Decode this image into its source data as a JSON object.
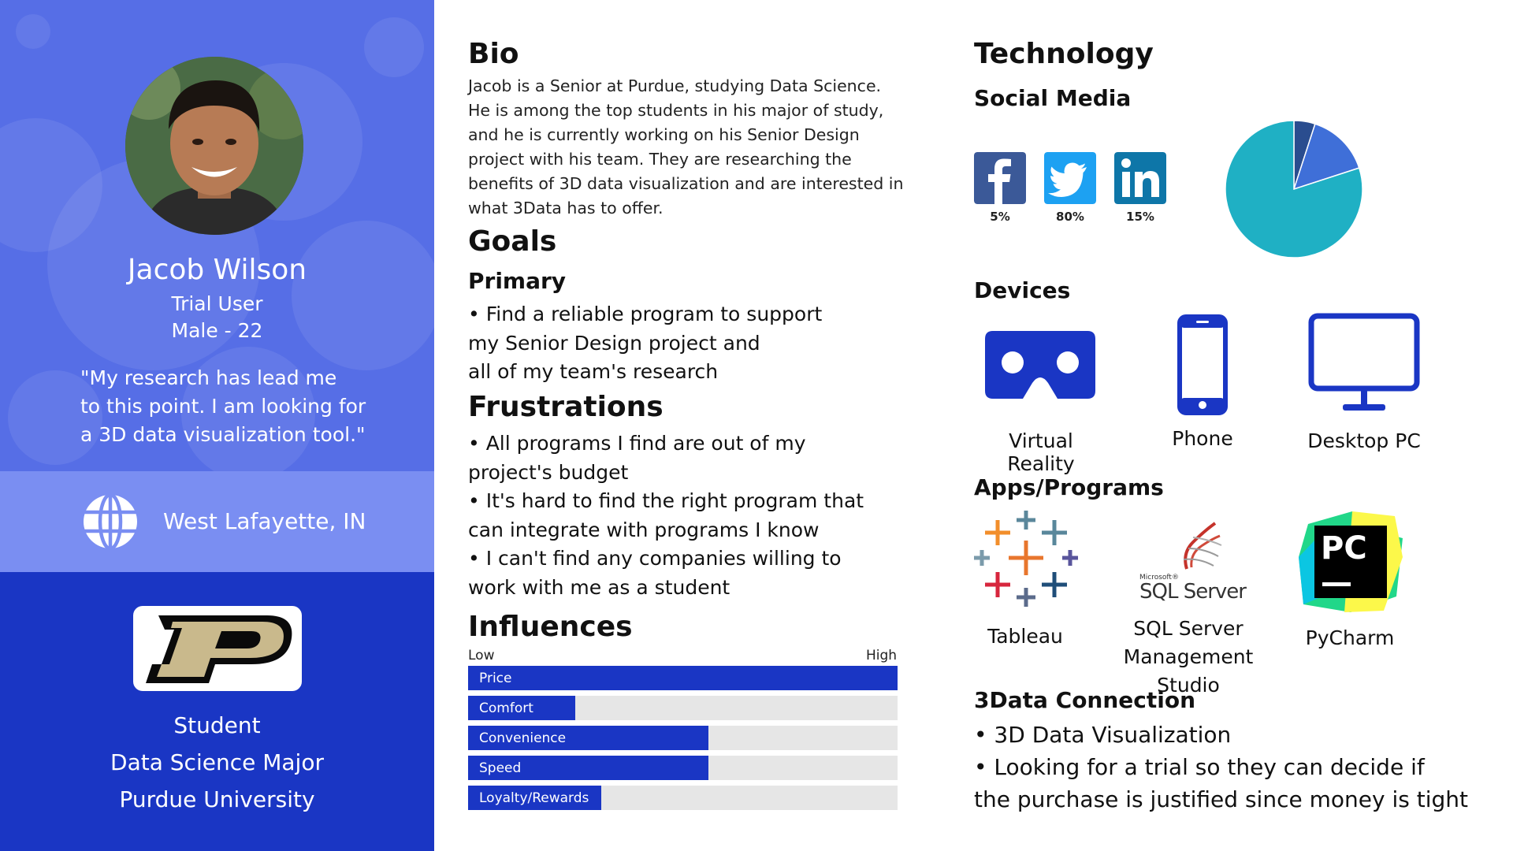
{
  "persona": {
    "name": "Jacob Wilson",
    "role": "Trial User",
    "demographics": "Male - 22",
    "quote": "\"My research has lead me\nto this point. I am looking for\na 3D data visualization tool.\"",
    "location": "West Lafayette, IN",
    "education": [
      "Student",
      "Data Science Major",
      "Purdue University"
    ]
  },
  "bio": {
    "heading": "Bio",
    "text": "Jacob is a Senior at Purdue, studying Data Science.\nHe is among the top students in his major of study,\nand he is currently working on his Senior Design\nproject with his team. They are researching the\nbenefits of 3D data visualization and are interested in\nwhat 3Data has to offer."
  },
  "goals": {
    "heading": "Goals",
    "primary_heading": "Primary",
    "primary_text": "• Find a reliable program to support\nmy Senior Design project and\nall of my team's research"
  },
  "frustrations": {
    "heading": "Frustrations",
    "text": "• All programs I find are out of my\nproject's budget\n• It's hard to find the right program that\ncan integrate with programs I know\n• I can't find any companies willing to\nwork with me as a student"
  },
  "influences": {
    "heading": "Influences",
    "low_label": "Low",
    "high_label": "High",
    "items": [
      {
        "label": "Price",
        "value": 1.0
      },
      {
        "label": "Comfort",
        "value": 0.25
      },
      {
        "label": "Convenience",
        "value": 0.56
      },
      {
        "label": "Speed",
        "value": 0.56
      },
      {
        "label": "Loyalty/Rewards",
        "value": 0.31
      }
    ]
  },
  "technology": {
    "heading": "Technology",
    "social_heading": "Social Media",
    "social": [
      {
        "name": "facebook-icon",
        "pct": "5%",
        "color": "#3b5998"
      },
      {
        "name": "twitter-icon",
        "pct": "80%",
        "color": "#1da1f2"
      },
      {
        "name": "linkedin-icon",
        "pct": "15%",
        "color": "#0e76a8"
      }
    ],
    "pie": {
      "type": "pie",
      "values": [
        5,
        15,
        80
      ],
      "colors": [
        "#2a4d8f",
        "#3f6fd8",
        "#1fb0c4"
      ]
    },
    "devices_heading": "Devices",
    "devices": [
      "Virtual Reality",
      "Phone",
      "Desktop PC"
    ],
    "device_color": "#1a36c4",
    "apps_heading": "Apps/Programs",
    "apps": [
      "Tableau",
      "SQL Server\nManagement Studio",
      "PyCharm"
    ],
    "sql_logo_small": "Microsoft®",
    "sql_logo_text": "SQL Server",
    "pycharm_logo_text": "PC"
  },
  "connection": {
    "heading": "3Data Connection",
    "text": "• 3D Data Visualization\n• Looking for a trial so they can decide if\nthe purchase is justified since money is tight"
  }
}
